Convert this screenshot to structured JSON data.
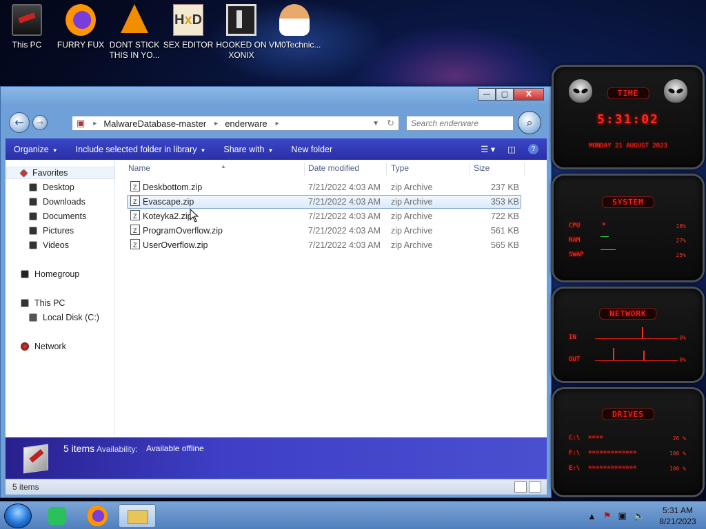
{
  "desktop": {
    "icons": [
      {
        "label": "This PC"
      },
      {
        "label": "FURRY FUX"
      },
      {
        "label": "DONT STICK THIS IN YO..."
      },
      {
        "label": "SEX EDITOR"
      },
      {
        "label": "HOOKED ON XONIX"
      },
      {
        "label": "VM0Technic..."
      }
    ]
  },
  "window": {
    "controls": {
      "minimize": "—",
      "maximize": "▢",
      "close": "X"
    },
    "address": {
      "crumbs": [
        "MalwareDatabase-master",
        "enderware"
      ]
    },
    "search": {
      "placeholder": "Search enderware"
    },
    "toolbar": {
      "organize": "Organize",
      "include": "Include selected folder in library",
      "share": "Share with",
      "new_folder": "New folder"
    },
    "nav": {
      "favorites": "Favorites",
      "desktop": "Desktop",
      "downloads": "Downloads",
      "documents": "Documents",
      "pictures": "Pictures",
      "videos": "Videos",
      "homegroup": "Homegroup",
      "this_pc": "This PC",
      "local_disk": "Local Disk (C:)",
      "network": "Network"
    },
    "columns": {
      "name": "Name",
      "date": "Date modified",
      "type": "Type",
      "size": "Size"
    },
    "files": [
      {
        "name": "Deskbottom.zip",
        "date": "7/21/2022 4:03 AM",
        "type": "zip Archive",
        "size": "237 KB"
      },
      {
        "name": "Evascape.zip",
        "date": "7/21/2022 4:03 AM",
        "type": "zip Archive",
        "size": "353 KB",
        "selected": true
      },
      {
        "name": "Koteyka2.zip",
        "date": "7/21/2022 4:03 AM",
        "type": "zip Archive",
        "size": "722 KB"
      },
      {
        "name": "ProgramOverflow.zip",
        "date": "7/21/2022 4:03 AM",
        "type": "zip Archive",
        "size": "561 KB"
      },
      {
        "name": "UserOverflow.zip",
        "date": "7/21/2022 4:03 AM",
        "type": "zip Archive",
        "size": "565 KB"
      }
    ],
    "details": {
      "count": "5 items",
      "availability_label": "Availability:",
      "availability_value": "Available offline"
    },
    "status": {
      "text": "5 items"
    }
  },
  "gadgets": {
    "time": {
      "title": "TIME",
      "clock": "5:31:02",
      "date": "MONDAY 21 AUGUST 2023"
    },
    "system": {
      "title": "SYSTEM",
      "cpu_label": "CPU",
      "ram_label": "RAM",
      "swap_label": "SWAP",
      "cpu": "18%",
      "ram": "27%",
      "swap": "25%"
    },
    "network": {
      "title": "NETWORK",
      "in_label": "IN",
      "out_label": "OUT",
      "in": "0%",
      "out": "0%"
    },
    "drives": {
      "title": "DRIVES",
      "c_label": "C:\\",
      "f_label": "F:\\",
      "e_label": "E:\\",
      "c": "26 %",
      "f": "100 %",
      "e": "100 %"
    }
  },
  "taskbar": {
    "clock_time": "5:31 AM",
    "clock_date": "8/21/2023"
  }
}
